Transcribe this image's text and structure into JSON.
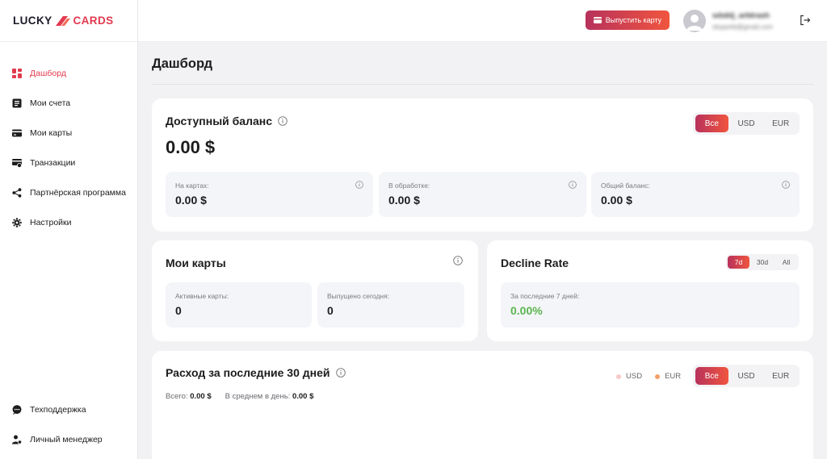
{
  "logo": {
    "part1": "LUCKY",
    "part2": "CARDS"
  },
  "sidebar": {
    "items": [
      {
        "label": "Дашборд",
        "icon": "dashboard-icon",
        "active": true
      },
      {
        "label": "Мои счета",
        "icon": "accounts-icon"
      },
      {
        "label": "Мои карты",
        "icon": "card-icon"
      },
      {
        "label": "Транзакции",
        "icon": "transactions-icon"
      },
      {
        "label": "Партнёрская программа",
        "icon": "share-icon"
      },
      {
        "label": "Настройки",
        "icon": "gear-icon"
      }
    ],
    "bottom_items": [
      {
        "label": "Техподдержка",
        "icon": "chat-icon"
      },
      {
        "label": "Личный менеджер",
        "icon": "manager-icon"
      }
    ]
  },
  "topbar": {
    "issue_button": "Выпустить карту",
    "user_name": "sdsktj_arbtrash",
    "user_email": "sksperbt@gmail.com"
  },
  "page": {
    "title": "Дашборд"
  },
  "balance": {
    "title": "Доступный баланс",
    "amount": "0.00 $",
    "currency_options": [
      "Все",
      "USD",
      "EUR"
    ],
    "selected": "Все",
    "stats": [
      {
        "label": "На картах:",
        "value": "0.00 $"
      },
      {
        "label": "В обработке:",
        "value": "0.00 $"
      },
      {
        "label": "Общий баланс:",
        "value": "0.00 $"
      }
    ]
  },
  "my_cards": {
    "title": "Мои карты",
    "stats": [
      {
        "label": "Активные карты:",
        "value": "0"
      },
      {
        "label": "Выпущено сегодня:",
        "value": "0"
      }
    ]
  },
  "decline_rate": {
    "title": "Decline Rate",
    "period_options": [
      "7d",
      "30d",
      "All"
    ],
    "selected": "7d",
    "stat": {
      "label": "За последние 7 дней:",
      "value": "0.00%"
    }
  },
  "spending": {
    "title": "Расход за последние 30 дней",
    "legend": [
      {
        "label": "USD",
        "color": "#f7c8c8"
      },
      {
        "label": "EUR",
        "color": "#f4a06a"
      }
    ],
    "currency_options": [
      "Все",
      "USD",
      "EUR"
    ],
    "selected": "Все",
    "total_label": "Всего:",
    "total_value": "0.00 $",
    "avg_label": "В среднем в день:",
    "avg_value": "0.00 $"
  },
  "colors": {
    "accent": "#e23a4e",
    "gradient_start": "#b8325c",
    "gradient_end": "#f0553e",
    "positive": "#5ab64f"
  }
}
